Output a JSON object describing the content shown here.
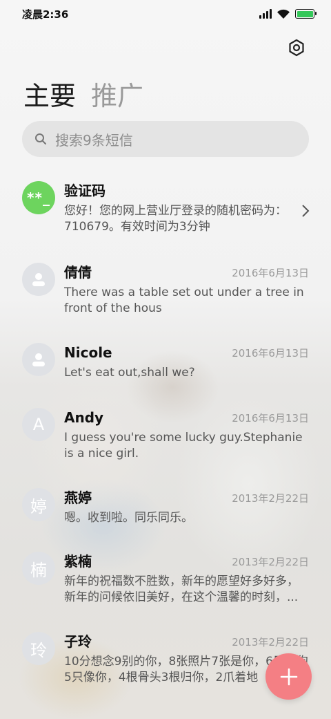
{
  "status_bar": {
    "time": "凌晨2:36",
    "battery_level": 1.0,
    "battery_color": "#34c759"
  },
  "header": {
    "settings_icon": "settings-hexagon-icon",
    "tabs": [
      {
        "label": "主要",
        "active": true
      },
      {
        "label": "推广",
        "active": false
      }
    ]
  },
  "search": {
    "placeholder": "搜索9条短信",
    "icon": "search-icon"
  },
  "messages": [
    {
      "name": "验证码",
      "avatar": "**_",
      "avatar_color": "#6dd45e",
      "date": "",
      "preview": "您好！您的网上营业厅登录的随机密码为：710679。有效时间为3分钟",
      "has_chevron": true
    },
    {
      "name": "倩倩",
      "avatar": "person-icon",
      "date": "2016年6月13日",
      "preview": "There was a table set out under a tree in front of the hous"
    },
    {
      "name": "Nicole",
      "avatar": "person-icon",
      "date": "2016年6月13日",
      "preview": "Let's eat out,shall we?"
    },
    {
      "name": "Andy",
      "avatar": "A",
      "date": "2016年6月13日",
      "preview": "I guess you're some lucky guy.Stephanie is a nice girl."
    },
    {
      "name": "燕婷",
      "avatar": "婷",
      "date": "2013年2月22日",
      "preview": "嗯。收到啦。同乐同乐。"
    },
    {
      "name": "紫楠",
      "avatar": "楠",
      "date": "2013年2月22日",
      "preview": "新年的祝福数不胜数，新年的愿望好多好多，新年的问候依旧美好，在这个温馨的时刻，..."
    },
    {
      "name": "子玲",
      "avatar": "玲",
      "date": "2013年2月22日",
      "preview": "10分想念9别的你，8张照片7张是你，6只小狗5只像你，4根骨头3根归你，2爪着地"
    }
  ],
  "fab": {
    "icon": "plus-icon",
    "color": "#f47f84"
  }
}
